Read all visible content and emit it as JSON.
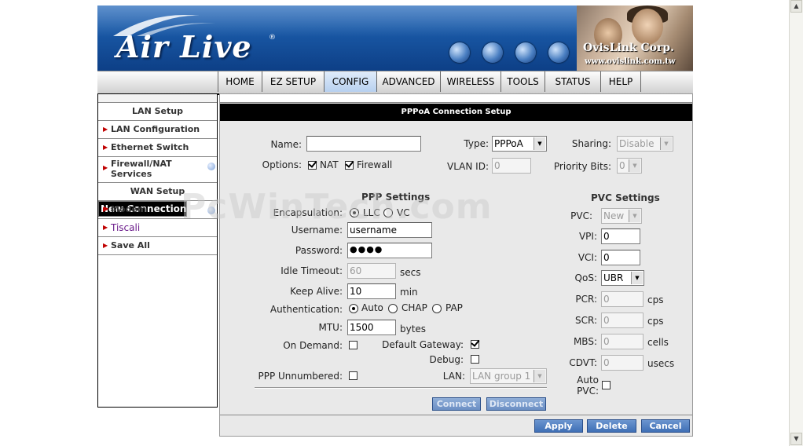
{
  "banner": {
    "brand": "Air Live",
    "brand_mark": "®",
    "company": "OvisLink Corp.",
    "company_url": "www.ovislink.com.tw"
  },
  "nav": {
    "items": [
      "HOME",
      "EZ SETUP",
      "CONFIG",
      "ADVANCED",
      "WIRELESS",
      "TOOLS",
      "STATUS",
      "HELP"
    ],
    "active": "CONFIG"
  },
  "sidebar": {
    "sections": [
      {
        "header": "LAN Setup"
      },
      {
        "header": "WAN Setup"
      }
    ],
    "items": [
      {
        "label": "LAN Configuration"
      },
      {
        "label": "Ethernet Switch"
      },
      {
        "label": "Firewall/NAT Services"
      },
      {
        "label": "New Connection"
      },
      {
        "label": "Modem"
      },
      {
        "label": "Tiscali"
      },
      {
        "label": "Save All"
      }
    ]
  },
  "main": {
    "title": "PPPoA Connection Setup",
    "name_label": "Name:",
    "name_value": "",
    "type_label": "Type:",
    "type_value": "PPPoA",
    "sharing_label": "Sharing:",
    "sharing_value": "Disable",
    "options_label": "Options:",
    "nat_label": "NAT",
    "nat_checked": true,
    "firewall_label": "Firewall",
    "firewall_checked": true,
    "vlan_label": "VLAN ID:",
    "vlan_value": "0",
    "priority_label": "Priority Bits:",
    "priority_value": "0",
    "ppp_settings": {
      "heading": "PPP Settings",
      "encapsulation_label": "Encapsulation:",
      "encapsulation_options": [
        "LLC",
        "VC"
      ],
      "encapsulation_selected": "LLC",
      "username_label": "Username:",
      "username_value": "username",
      "password_label": "Password:",
      "password_value": "●●●●",
      "idle_label": "Idle Timeout:",
      "idle_value": "60",
      "idle_unit": "secs",
      "keepalive_label": "Keep Alive:",
      "keepalive_value": "10",
      "keepalive_unit": "min",
      "auth_label": "Authentication:",
      "auth_options": [
        "Auto",
        "CHAP",
        "PAP"
      ],
      "auth_selected": "Auto",
      "mtu_label": "MTU:",
      "mtu_value": "1500",
      "mtu_unit": "bytes",
      "ondemand_label": "On Demand:",
      "ondemand_checked": false,
      "defgw_label": "Default Gateway:",
      "defgw_checked": true,
      "debug_label": "Debug:",
      "debug_checked": false,
      "unnumbered_label": "PPP Unnumbered:",
      "unnumbered_checked": false,
      "lan_label": "LAN:",
      "lan_value": "LAN group 1"
    },
    "pvc_settings": {
      "heading": "PVC Settings",
      "pvc_label": "PVC:",
      "pvc_value": "New",
      "vpi_label": "VPI:",
      "vpi_value": "0",
      "vci_label": "VCI:",
      "vci_value": "0",
      "qos_label": "QoS:",
      "qos_value": "UBR",
      "pcr_label": "PCR:",
      "pcr_value": "0",
      "pcr_unit": "cps",
      "scr_label": "SCR:",
      "scr_value": "0",
      "scr_unit": "cps",
      "mbs_label": "MBS:",
      "mbs_value": "0",
      "mbs_unit": "cells",
      "cdvt_label": "CDVT:",
      "cdvt_value": "0",
      "cdvt_unit": "usecs",
      "autopvc_label1": "Auto",
      "autopvc_label2": "PVC:",
      "autopvc_checked": false
    },
    "connect_label": "Connect",
    "disconnect_label": "Disconnect",
    "apply_label": "Apply",
    "delete_label": "Delete",
    "cancel_label": "Cancel"
  },
  "watermark": "PcWinTech.com",
  "colors": {
    "banner_blue": "#1a5aa8",
    "button_blue": "#3f6fb6",
    "sidebar_arrow": "#c00000",
    "panel_bg": "#e9e9e9"
  }
}
